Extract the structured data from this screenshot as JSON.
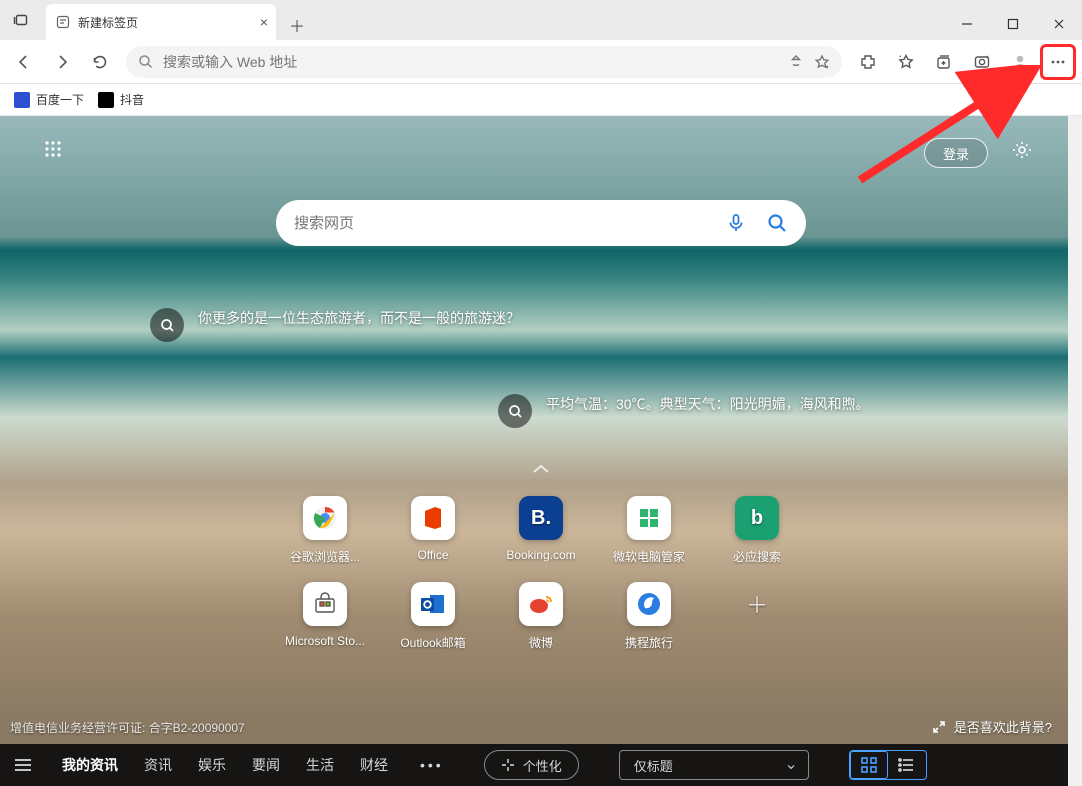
{
  "tab": {
    "title": "新建标签页"
  },
  "address": {
    "placeholder": "搜索或输入 Web 地址"
  },
  "bookmarks": [
    {
      "label": "百度一下",
      "icon_bg": "#2e4fd0"
    },
    {
      "label": "抖音",
      "icon_bg": "#000000"
    }
  ],
  "content": {
    "login_label": "登录",
    "search_placeholder": "搜索网页",
    "chips": [
      "你更多的是一位生态旅游者，而不是一般的旅游迷？",
      "平均气温：30℃。典型天气：阳光明媚，海风和煦。"
    ],
    "tiles_row1": [
      {
        "label": "谷歌浏览器...",
        "letter": "G",
        "bg": "#ffffff"
      },
      {
        "label": "Office",
        "letter": "O",
        "bg": "#ffffff"
      },
      {
        "label": "Booking.com",
        "letter": "B.",
        "bg": "#0b3f91"
      },
      {
        "label": "微软电脑管家",
        "letter": "■",
        "bg": "#ffffff"
      },
      {
        "label": "必应搜索",
        "letter": "b",
        "bg": "#1aa071"
      }
    ],
    "tiles_row2": [
      {
        "label": "Microsoft Sto...",
        "letter": "⊞",
        "bg": "#ffffff"
      },
      {
        "label": "Outlook邮箱",
        "letter": "O",
        "bg": "#ffffff"
      },
      {
        "label": "微博",
        "letter": "微",
        "bg": "#ffffff"
      },
      {
        "label": "携程旅行",
        "letter": "C",
        "bg": "#ffffff"
      }
    ],
    "footer_left": "增值电信业务经营许可证: 合字B2-20090007",
    "footer_right": "是否喜欢此背景?",
    "bottom": {
      "items": [
        "我的资讯",
        "资讯",
        "娱乐",
        "要闻",
        "生活",
        "财经"
      ],
      "personalize": "个性化",
      "select_value": "仅标题"
    }
  }
}
